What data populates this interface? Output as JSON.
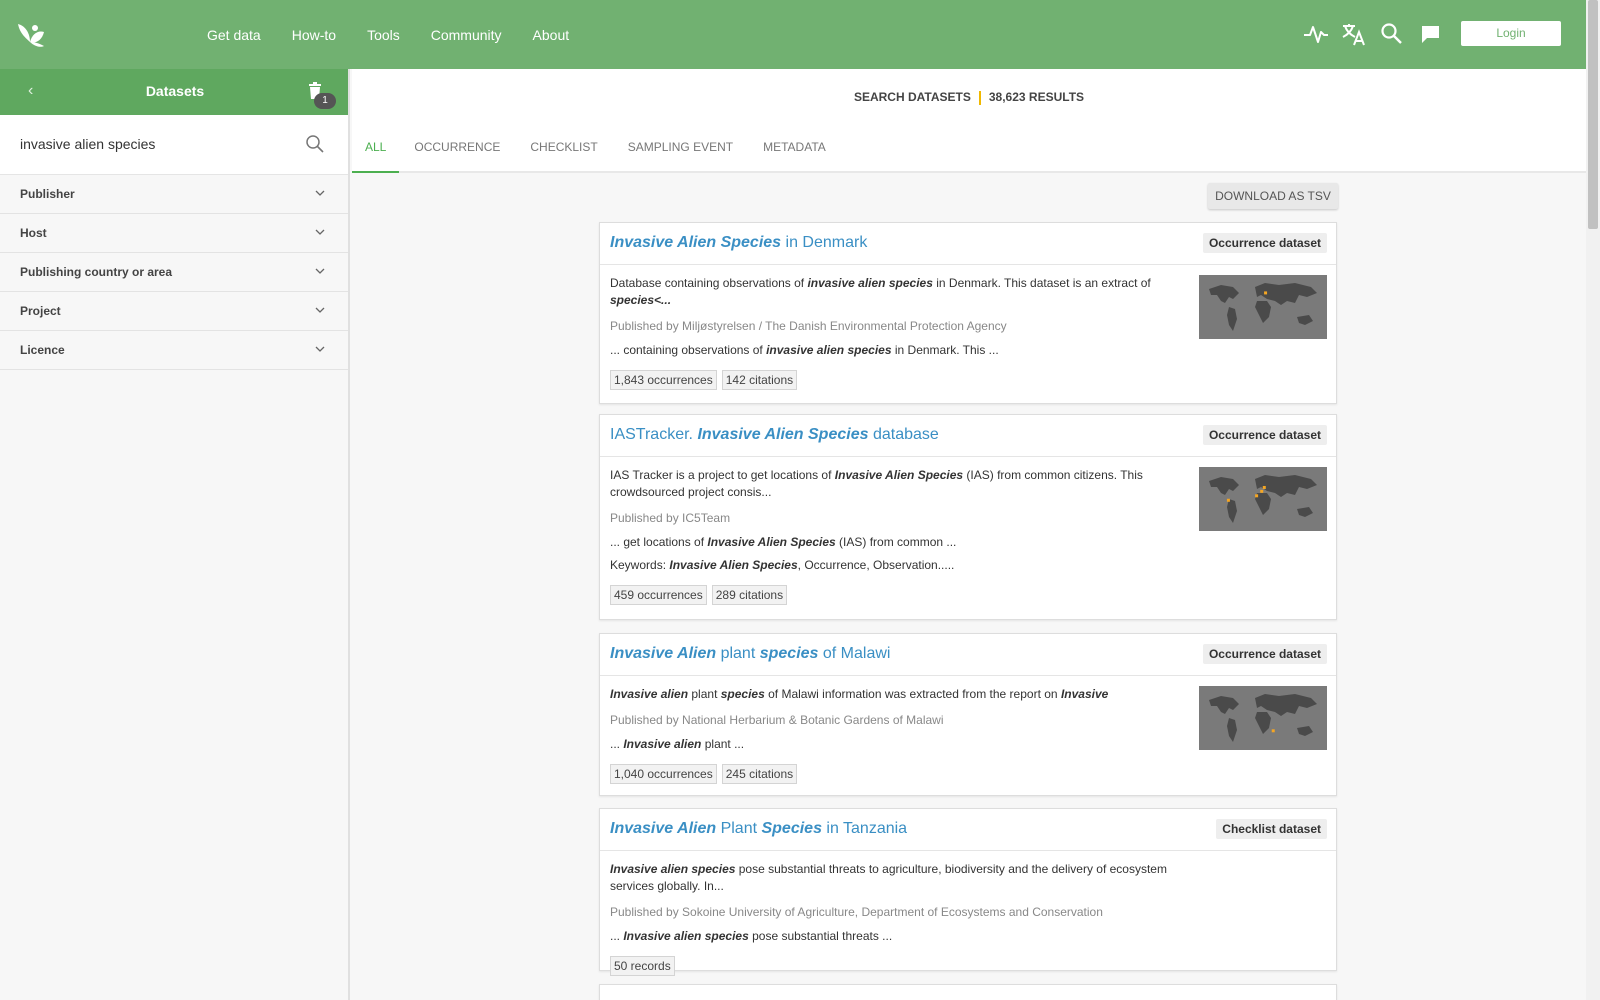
{
  "topbar": {
    "nav": [
      "Get data",
      "How-to",
      "Tools",
      "Community",
      "About"
    ],
    "icons": [
      "activity-icon",
      "translate-icon",
      "search-icon",
      "chat-icon"
    ],
    "login_label": "Login",
    "brand_color": "#71b171"
  },
  "sidebar": {
    "title": "Datasets",
    "filter_count": "1",
    "search_value": "invasive alien species",
    "facets": [
      "Publisher",
      "Host",
      "Publishing country or area",
      "Project",
      "Licence"
    ]
  },
  "results": {
    "label": "SEARCH DATASETS",
    "count": "38,623 RESULTS",
    "tabs": [
      "ALL",
      "OCCURRENCE",
      "CHECKLIST",
      "SAMPLING EVENT",
      "METADATA"
    ],
    "download_label": "DOWNLOAD AS TSV"
  },
  "cards": [
    {
      "title_html": "<i>Invasive Alien Species</i> in Denmark",
      "type": "Occurrence dataset",
      "desc_html": "Database containing observations of <b>invasive alien species</b> in Denmark. This dataset is an extract of <b>species&lt;...</b>",
      "publisher": "Published by Miljøstyrelsen / The Danish Environmental Protection Agency",
      "snippet_html": "... containing observations of <b>invasive alien species</b> in Denmark. This ...",
      "keywords_html": "",
      "chips": [
        "1,843 occurrences",
        "142 citations"
      ],
      "has_map": true,
      "map_dots": [
        [
          0.52,
          0.28
        ]
      ]
    },
    {
      "title_html": "IASTracker. <i>Invasive Alien Species</i> database",
      "type": "Occurrence dataset",
      "desc_html": "IAS Tracker is a project to get locations of <b>Invasive Alien Species</b> (IAS) from common citizens. This crowdsourced project consis...",
      "publisher": "Published by IC5Team",
      "snippet_html": "... get locations of <b>Invasive Alien Species</b> (IAS) from common ...",
      "keywords_html": "Keywords: <b>Invasive Alien Species</b>, Occurrence, Observation.....",
      "chips": [
        "459 occurrences",
        "289 citations"
      ],
      "has_map": true,
      "map_dots": [
        [
          0.51,
          0.32
        ],
        [
          0.49,
          0.38
        ],
        [
          0.45,
          0.45
        ],
        [
          0.23,
          0.52
        ]
      ]
    },
    {
      "title_html": "<i>Invasive Alien</i> plant <i>species</i> of Malawi",
      "type": "Occurrence dataset",
      "desc_html": "<b>Invasive alien</b> plant <b>species</b> of Malawi information was extracted from the report on <b>Invasive</b>",
      "publisher": "Published by National Herbarium &amp; Botanic Gardens of Malawi",
      "snippet_html": "... <b>Invasive alien</b> plant ...",
      "keywords_html": "",
      "chips": [
        "1,040 occurrences",
        "245 citations"
      ],
      "has_map": true,
      "map_dots": [
        [
          0.58,
          0.7
        ]
      ]
    },
    {
      "title_html": "<i>Invasive Alien</i> Plant <i>Species</i> in Tanzania",
      "type": "Checklist dataset",
      "desc_html": "<b>Invasive alien species</b> pose substantial threats to agriculture, biodiversity and the delivery of ecosystem services globally. In...",
      "publisher": "Published by Sokoine University of Agriculture, Department of Ecosystems and Conservation",
      "snippet_html": "... <b>Invasive alien species</b> pose substantial threats ...",
      "keywords_html": "",
      "chips": [
        "50 records"
      ],
      "has_map": false,
      "map_dots": []
    }
  ]
}
